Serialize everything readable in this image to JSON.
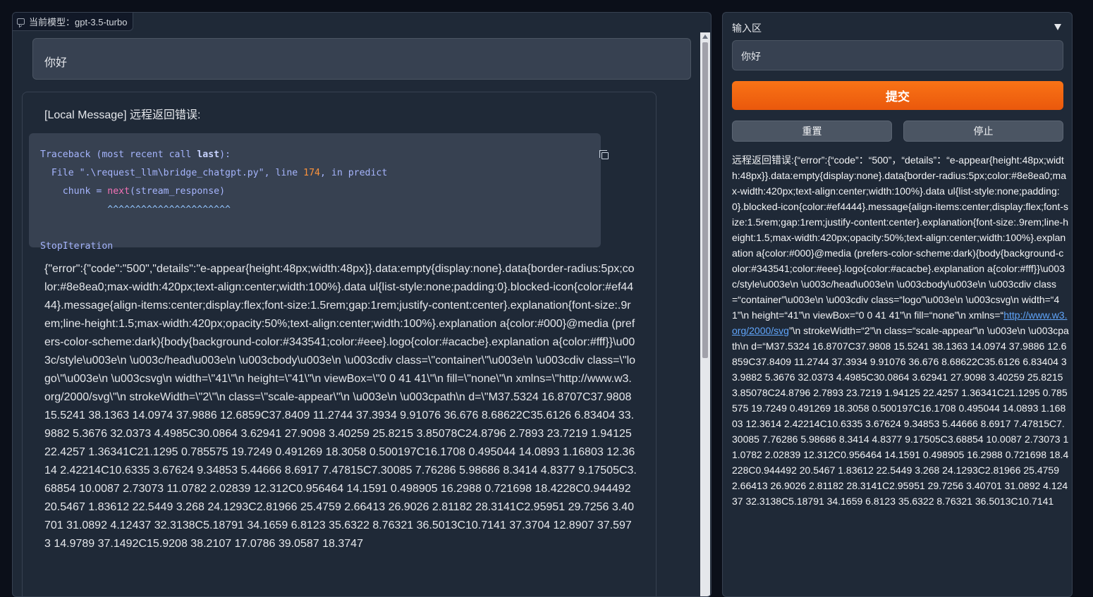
{
  "chat": {
    "model_label": "当前模型：gpt-3.5-turbo",
    "user_message": "你好",
    "bot_title": "[Local Message] 远程返回错误:",
    "code": {
      "line1_a": "Traceback (most recent call ",
      "line1_kw": "last",
      "line1_b": "):",
      "line2_a": "  File \".\\request_llm\\bridge_chatgpt.py\", line ",
      "line2_num": "174",
      "line2_b": ", in predict",
      "line3_a": "    chunk = ",
      "line3_fn": "next",
      "line3_b": "(stream_response)",
      "line4": "            ^^^^^^^^^^^^^^^^^^^^^^",
      "line5": "StopIteration"
    },
    "bot_body": "{\"error\":{\"code\":\"500\",\"details\":\"e-appear{height:48px;width:48px}}.data:empty{display:none}.data{border-radius:5px;color:#8e8ea0;max-width:420px;text-align:center;width:100%}.data ul{list-style:none;padding:0}.blocked-icon{color:#ef4444}.message{align-items:center;display:flex;font-size:1.5rem;gap:1rem;justify-content:center}.explanation{font-size:.9rem;line-height:1.5;max-width:420px;opacity:50%;text-align:center;width:100%}.explanation a{color:#000}@media (prefers-color-scheme:dark){body{background-color:#343541;color:#eee}.logo{color:#acacbe}.explanation a{color:#fff}}\\u003c/style\\u003e\\n \\u003c/head\\u003e\\n \\u003cbody\\u003e\\n \\u003cdiv class=\\\"container\\\"\\u003e\\n \\u003cdiv class=\\\"logo\\\"\\u003e\\n \\u003csvg\\n width=\\\"41\\\"\\n height=\\\"41\\\"\\n viewBox=\\\"0 0 41 41\\\"\\n fill=\\\"none\\\"\\n xmlns=\\\"http://www.w3.org/2000/svg\\\"\\n strokeWidth=\\\"2\\\"\\n class=\\\"scale-appear\\\"\\n \\u003e\\n \\u003cpath\\n d=\\\"M37.5324 16.8707C37.9808 15.5241 38.1363 14.0974 37.9886 12.6859C37.8409 11.2744 37.3934 9.91076 36.676 8.68622C35.6126 6.83404 33.9882 5.3676 32.0373 4.4985C30.0864 3.62941 27.9098 3.40259 25.8215 3.85078C24.8796 2.7893 23.7219 1.94125 22.4257 1.36341C21.1295 0.785575 19.7249 0.491269 18.3058 0.500197C16.1708 0.495044 14.0893 1.16803 12.3614 2.42214C10.6335 3.67624 9.34853 5.44666 8.6917 7.47815C7.30085 7.76286 5.98686 8.3414 4.8377 9.17505C3.68854 10.0087 2.73073 11.0782 2.02839 12.312C0.956464 14.1591 0.498905 16.2988 0.721698 18.4228C0.944492 20.5467 1.83612 22.5449 3.268 24.1293C2.81966 25.4759 2.66413 26.9026 2.81182 28.3141C2.95951 29.7256 3.40701 31.0892 4.12437 32.3138C5.18791 34.1659 6.8123 35.6322 8.76321 36.5013C10.7141 37.3704 12.8907 37.5973 14.9789 37.1492C15.9208 38.2107 17.0786 39.0587 18.3747"
  },
  "side": {
    "input_header": "输入区",
    "input_value": "你好",
    "submit_label": "提交",
    "reset_label": "重置",
    "stop_label": "停止",
    "output_before_link": "远程返回错误:{“error”:{“code”：“500”，“details”：“e-appear{height:48px;width:48px}}.data:empty{display:none}.data{border-radius:5px;color:#8e8ea0;max-width:420px;text-align:center;width:100%}.data ul{list-style:none;padding:0}.blocked-icon{color:#ef4444}.message{align-items:center;display:flex;font-size:1.5rem;gap:1rem;justify-content:center}.explanation{font-size:.9rem;line-height:1.5;max-width:420px;opacity:50%;text-align:center;width:100%}.explanation a{color:#000}@media (prefers-color-scheme:dark){body{background-color:#343541;color:#eee}.logo{color:#acacbe}.explanation a{color:#fff}}\\u003c/style\\u003e\\n \\u003c/head\\u003e\\n \\u003cbody\\u003e\\n \\u003cdiv class=“container”\\u003e\\n \\u003cdiv class=“logo”\\u003e\\n \\u003csvg\\n width=“41”\\n height=“41”\\n viewBox=“0 0 41 41”\\n fill=“none”\\n xmlns=“",
    "output_link": "http://www.w3.org/2000/svg",
    "output_after_link": "”\\n strokeWidth=“2”\\n class=“scale-appear”\\n \\u003e\\n \\u003cpath\\n d=“M37.5324 16.8707C37.9808 15.5241 38.1363 14.0974 37.9886 12.6859C37.8409 11.2744 37.3934 9.91076 36.676 8.68622C35.6126 6.83404 33.9882 5.3676 32.0373 4.4985C30.0864 3.62941 27.9098 3.40259 25.8215 3.85078C24.8796 2.7893 23.7219 1.94125 22.4257 1.36341C21.1295 0.785575 19.7249 0.491269 18.3058 0.500197C16.1708 0.495044 14.0893 1.16803 12.3614 2.42214C10.6335 3.67624 9.34853 5.44666 8.6917 7.47815C7.30085 7.76286 5.98686 8.3414 4.8377 9.17505C3.68854 10.0087 2.73073 11.0782 2.02839 12.312C0.956464 14.1591 0.498905 16.2988 0.721698 18.4228C0.944492 20.5467 1.83612 22.5449 3.268 24.1293C2.81966 25.4759 2.66413 26.9026 2.81182 28.3141C2.95951 29.7256 3.40701 31.0892 4.12437 32.3138C5.18791 34.1659 6.8123 35.6322 8.76321 36.5013C10.7141"
  },
  "colors": {
    "background": "#0b0f19",
    "panel": "#1f2937",
    "accent_orange": "#f97316",
    "link": "#60a5fa"
  },
  "icons": {
    "model": "chat-icon",
    "copy": "copy-icon",
    "collapse": "triangle-down-icon"
  }
}
